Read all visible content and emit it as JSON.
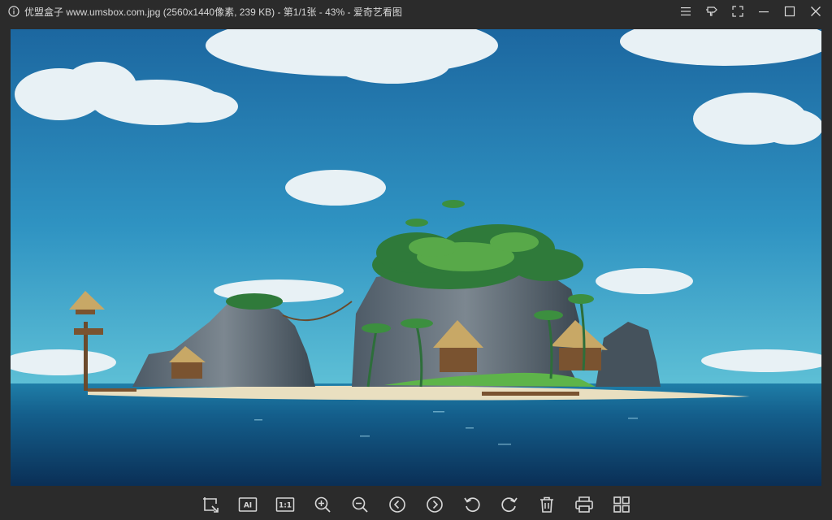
{
  "window": {
    "title": "优盟盒子 www.umsbox.com.jpg (2560x1440像素, 239 KB) - 第1/1张 - 43% - 爱奇艺看图"
  },
  "title_controls": [
    {
      "name": "menu-icon"
    },
    {
      "name": "pin-icon"
    },
    {
      "name": "fullscreen-icon"
    },
    {
      "name": "minimize-icon"
    },
    {
      "name": "maximize-icon"
    },
    {
      "name": "close-icon"
    }
  ],
  "toolbar": {
    "ai_label": "AI",
    "actual_size_label": "1:1",
    "tools": [
      "crop-icon",
      "ai-icon",
      "actual-size-icon",
      "zoom-in-icon",
      "zoom-out-icon",
      "previous-icon",
      "next-icon",
      "rotate-left-icon",
      "rotate-right-icon",
      "delete-icon",
      "print-icon",
      "grid-icon"
    ]
  },
  "colors": {
    "chrome": "#2b2b2b",
    "icon": "#d8d8d8",
    "sky_top": "#1f6fa8",
    "sky_bottom": "#4fb3cf",
    "sea": "#0f4e7a"
  }
}
